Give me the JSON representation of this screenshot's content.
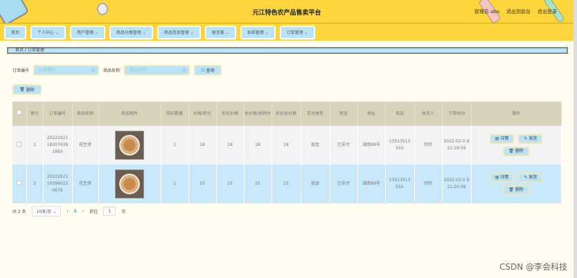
{
  "header": {
    "title": "元江特色农产品售卖平台",
    "user": "管理员 abo",
    "front": "退出到前台",
    "logout": "退出登录"
  },
  "nav": [
    "首页",
    "个人中心 ⌄",
    "用户管理 ⌄",
    "商品分类管理 ⌄",
    "商品信息管理 ⌄",
    "留言板 ⌄",
    "系统管理 ⌄",
    "订单管理 ⌄"
  ],
  "breadcrumb": {
    "home": "首页",
    "sep": "/",
    "current": "订单管理"
  },
  "search": {
    "order_label": "订单编号",
    "order_placeholder": "订单编号",
    "name_label": "商品名称",
    "name_placeholder": "商品名称",
    "query": "查询",
    "delete": "删除"
  },
  "columns": [
    "索引",
    "订单编号",
    "商品名称",
    "商品图片",
    "购买数量",
    "价格/积分",
    "折扣价格",
    "总价格/总积分",
    "折扣总价格",
    "支付类型",
    "状态",
    "地址",
    "电话",
    "收货人",
    "下单时间",
    "操作"
  ],
  "rows": [
    {
      "index": "1",
      "order_no": "20222921 18307439 1893",
      "name": "花生饼",
      "qty": "1",
      "price": "18",
      "discount": "18",
      "total": "18",
      "discount_total": "18",
      "pay": "现金",
      "status": "已支付",
      "address": "湖南88号",
      "phone": "13513513 555",
      "receiver": "欣欣",
      "time": "2022-02-0 9 21:18:59",
      "op1": "详情",
      "op2": "发货",
      "op3": "删除"
    },
    {
      "index": "2",
      "order_no": "20222921 19396022 0679",
      "name": "花生饼",
      "qty": "1",
      "price": "25",
      "discount": "25",
      "total": "25",
      "discount_total": "25",
      "pay": "现金",
      "status": "已支付",
      "address": "湖南88号",
      "phone": "13513513 555",
      "receiver": "欣欣",
      "time": "2022-02-0 9 21:20:08",
      "op1": "详情",
      "op2": "发货",
      "op3": "删除"
    }
  ],
  "pager": {
    "total": "共 2 条",
    "size": "10条/页 ⌄",
    "prev": "‹",
    "page": "1",
    "next": "›",
    "goto": "前往",
    "goto_value": "1",
    "unit": "页"
  },
  "watermark": "CSDN @李会科技"
}
